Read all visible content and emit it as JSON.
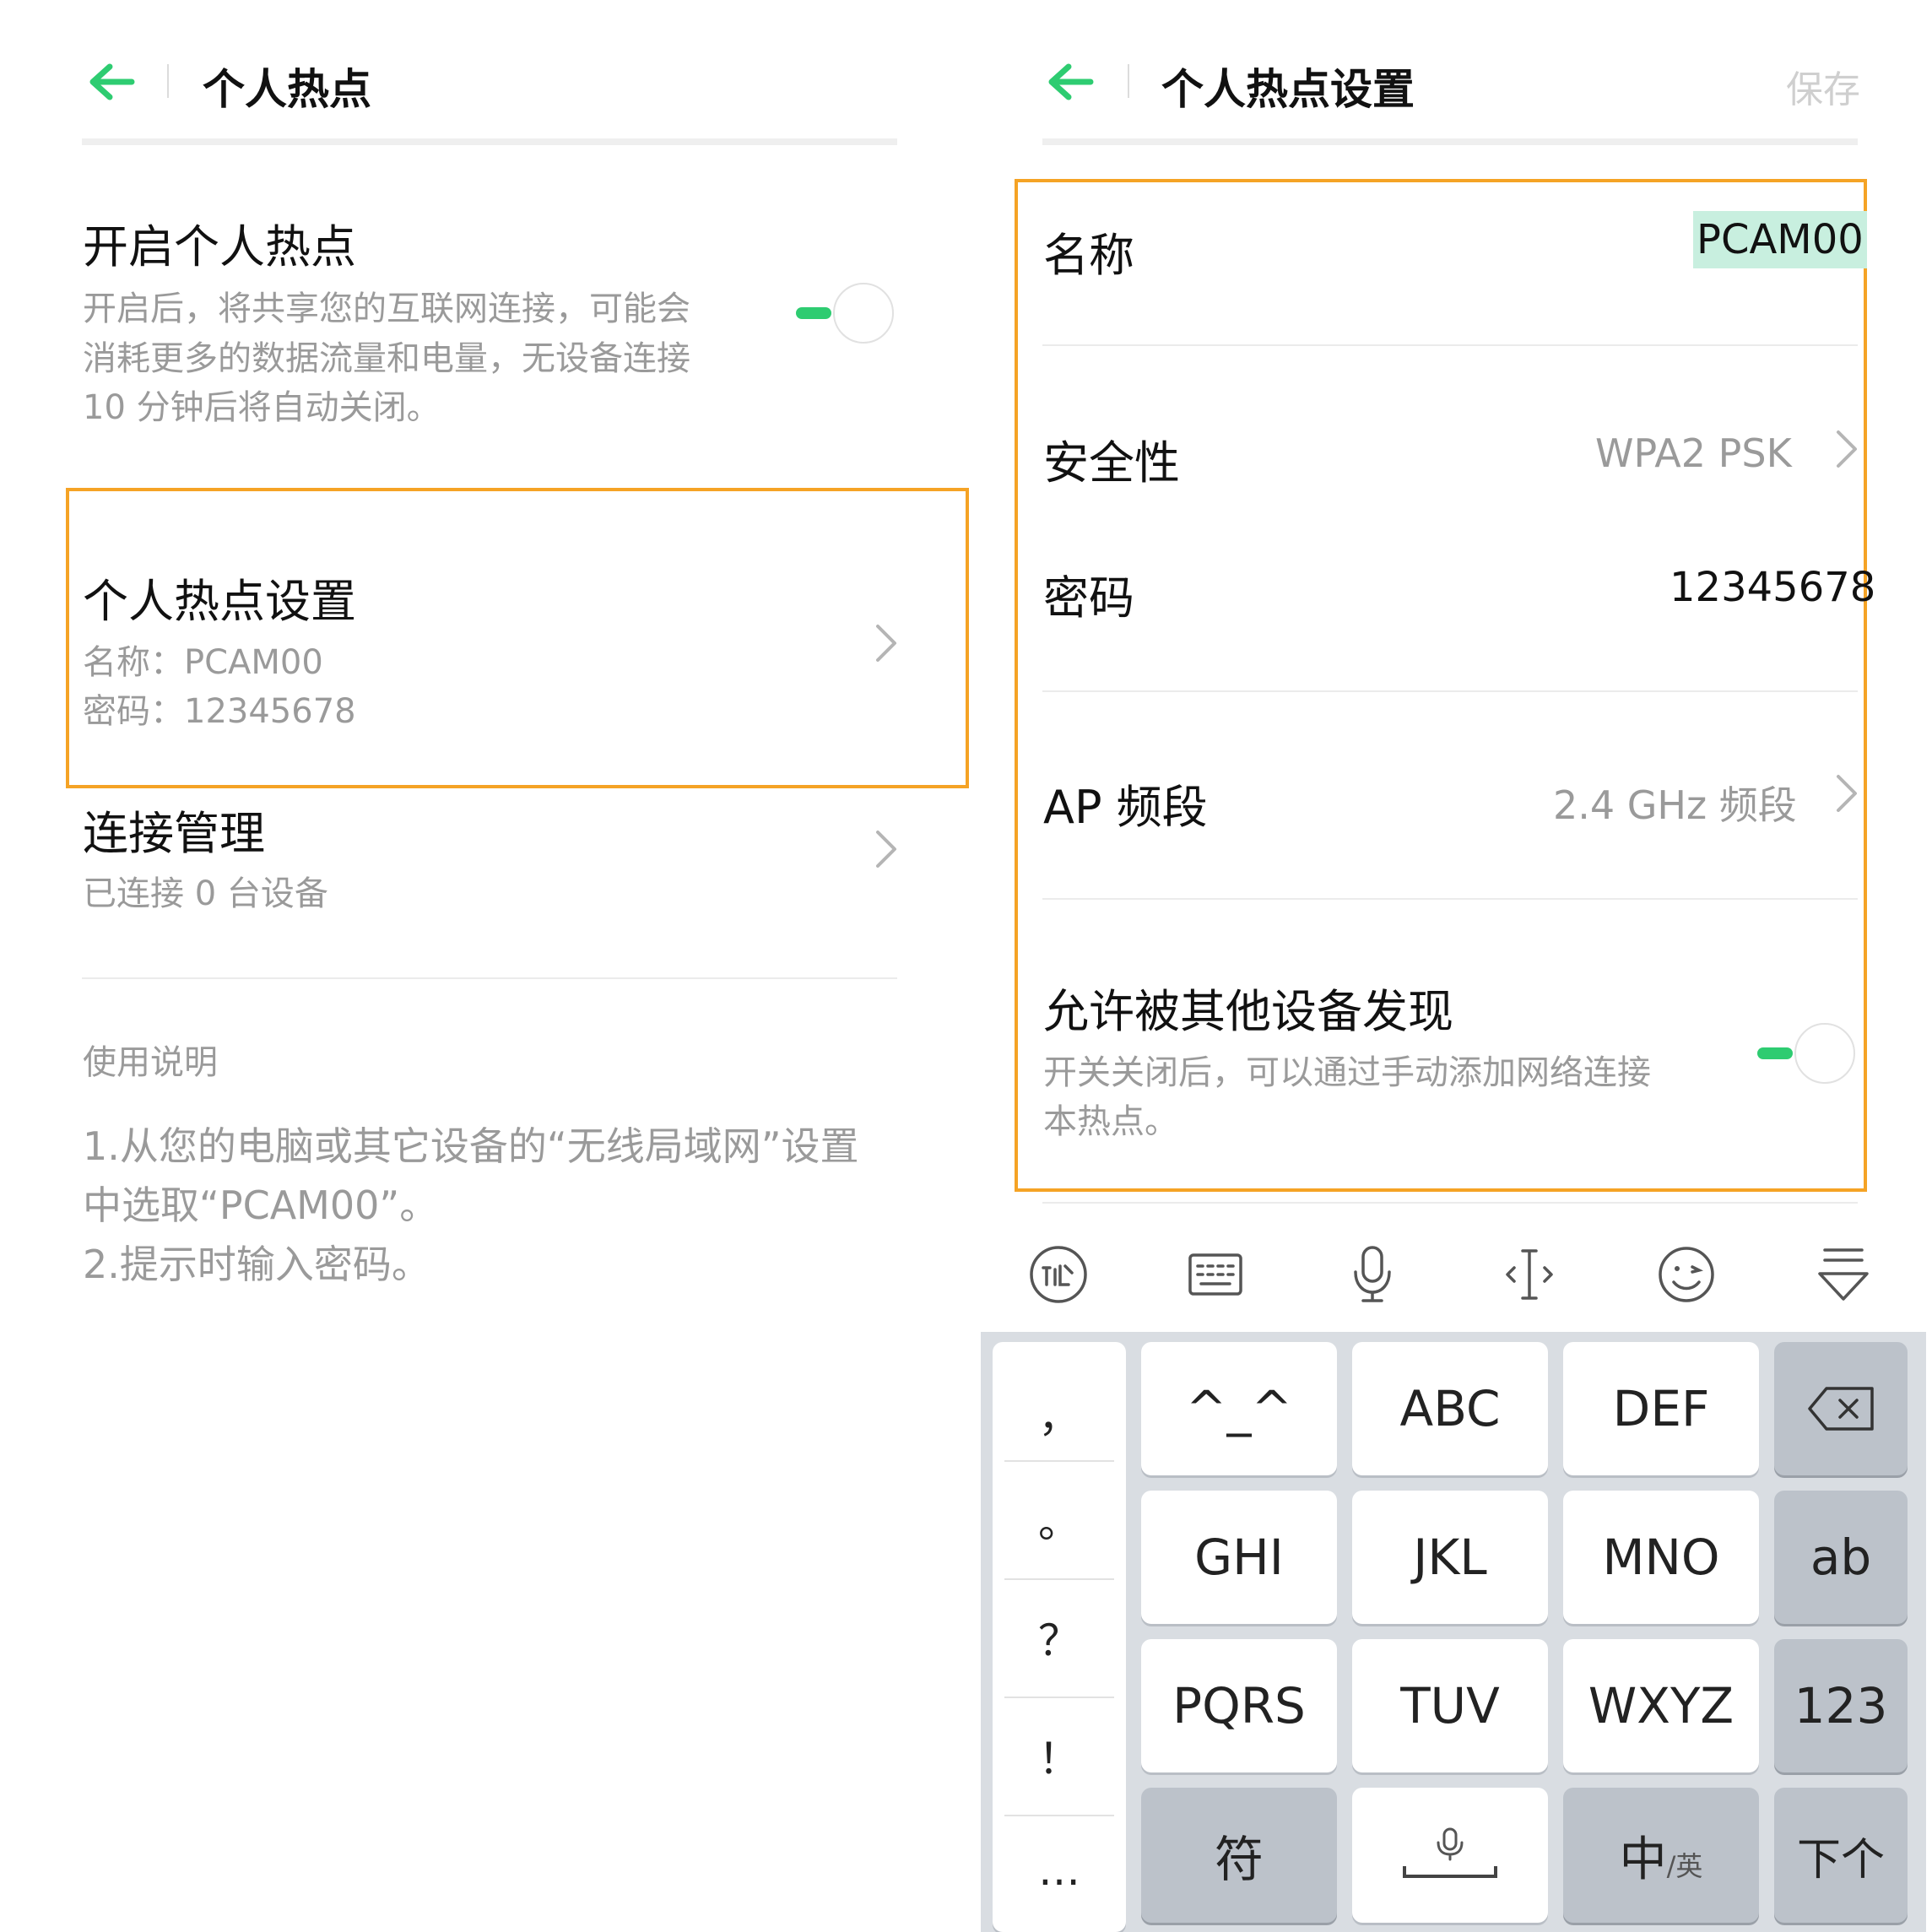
{
  "colors": {
    "accent": "#2ecc71",
    "highlight_box": "#f5a325",
    "name_highlight": "#c8efdf"
  },
  "left": {
    "header": {
      "title": "个人热点"
    },
    "enable": {
      "title": "开启个人热点",
      "desc_lines": [
        "开启后，将共享您的互联网连接，可能会",
        "消耗更多的数据流量和电量，无设备连接",
        "10 分钟后将自动关闭。"
      ],
      "toggle_on": true
    },
    "settings": {
      "title": "个人热点设置",
      "name_line": "名称：PCAM00",
      "password_line": "密码：12345678"
    },
    "connection": {
      "title": "连接管理",
      "subtitle": "已连接 0 台设备"
    },
    "usage": {
      "heading": "使用说明",
      "lines": [
        "1.从您的电脑或其它设备的“无线局域网”设置",
        "中选取“PCAM00”。",
        "2.提示时输入密码。"
      ]
    }
  },
  "right": {
    "header": {
      "title": "个人热点设置",
      "save_label": "保存"
    },
    "name": {
      "label": "名称",
      "value": "PCAM00"
    },
    "security": {
      "label": "安全性",
      "value": "WPA2 PSK"
    },
    "password": {
      "label": "密码",
      "value": "12345678"
    },
    "band": {
      "label": "AP 频段",
      "value": "2.4 GHz 频段"
    },
    "discover": {
      "title": "允许被其他设备发现",
      "desc_lines": [
        "开关关闭后，可以通过手动添加网络连接",
        "本热点。"
      ],
      "toggle_on": true
    }
  },
  "keyboard": {
    "toolbar_icons": [
      "ime-logo-icon",
      "keyboard-icon",
      "microphone-icon",
      "cursor-icon",
      "emoji-icon",
      "collapse-keyboard-icon"
    ],
    "symbols": [
      "，",
      "。",
      "？",
      "！",
      "…"
    ],
    "rows": [
      [
        "^_^",
        "ABC",
        "DEF"
      ],
      [
        "GHI",
        "JKL",
        "MNO"
      ],
      [
        "PQRS",
        "TUV",
        "WXYZ"
      ]
    ],
    "side": {
      "ab": "ab",
      "num": "123"
    },
    "bottom": {
      "symbol": "符",
      "lang_main": "中",
      "lang_sub": "/英",
      "next": "下个"
    }
  }
}
